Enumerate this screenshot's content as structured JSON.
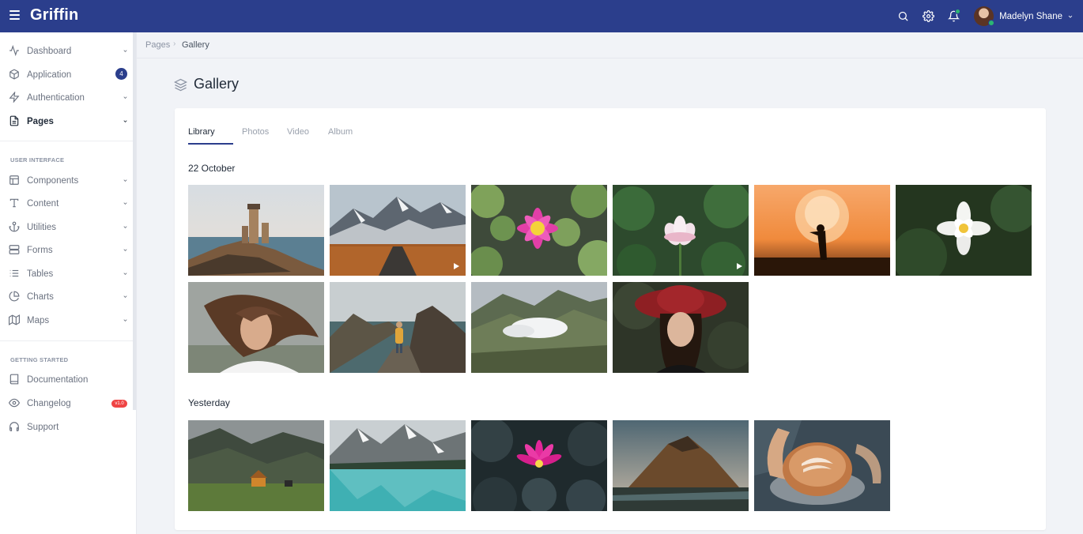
{
  "app": {
    "brand": "Griffin"
  },
  "topbar": {
    "user_name": "Madelyn Shane"
  },
  "sidebar": {
    "items": [
      {
        "label": "Dashboard",
        "icon": "activity-icon"
      },
      {
        "label": "Application",
        "icon": "box-icon",
        "badge": "4"
      },
      {
        "label": "Authentication",
        "icon": "zap-icon"
      },
      {
        "label": "Pages",
        "icon": "file-icon"
      }
    ],
    "section_ui": "USER INTERFACE",
    "ui_items": [
      {
        "label": "Components",
        "icon": "layout-icon"
      },
      {
        "label": "Content",
        "icon": "type-icon"
      },
      {
        "label": "Utilities",
        "icon": "anchor-icon"
      },
      {
        "label": "Forms",
        "icon": "server-icon"
      },
      {
        "label": "Tables",
        "icon": "list-icon"
      },
      {
        "label": "Charts",
        "icon": "pie-chart-icon"
      },
      {
        "label": "Maps",
        "icon": "map-icon"
      }
    ],
    "section_start": "GETTING STARTED",
    "start_items": [
      {
        "label": "Documentation",
        "icon": "book-icon"
      },
      {
        "label": "Changelog",
        "icon": "eye-icon",
        "badge": "v1.0"
      },
      {
        "label": "Support",
        "icon": "headphones-icon"
      }
    ]
  },
  "breadcrumb": {
    "parent": "Pages",
    "separator": "›",
    "current": "Gallery"
  },
  "page": {
    "title": "Gallery"
  },
  "tabs": [
    {
      "label": "Library",
      "active": true
    },
    {
      "label": "Photos"
    },
    {
      "label": "Video"
    },
    {
      "label": "Album"
    }
  ],
  "groups": [
    {
      "title": "22 October",
      "photos": [
        {
          "subject": "lighthouse",
          "video": false
        },
        {
          "subject": "mountain-road",
          "video": true
        },
        {
          "subject": "pink-lotus-lilypads",
          "video": false
        },
        {
          "subject": "white-pink-lotus",
          "video": true
        },
        {
          "subject": "sunset-silhouette",
          "video": false
        },
        {
          "subject": "white-water-lily",
          "video": false
        },
        {
          "subject": "windblown-hair-portrait",
          "video": false
        },
        {
          "subject": "hiker-on-cliff",
          "video": false
        },
        {
          "subject": "mountain-clouds",
          "video": false
        },
        {
          "subject": "woman-red-hat",
          "video": false
        }
      ]
    },
    {
      "title": "Yesterday",
      "photos": [
        {
          "subject": "cabin-in-valley",
          "video": false
        },
        {
          "subject": "turquoise-lake",
          "video": false
        },
        {
          "subject": "magenta-water-lily",
          "video": false
        },
        {
          "subject": "lone-mountain",
          "video": false
        },
        {
          "subject": "latte-art-cup",
          "video": false
        }
      ]
    }
  ],
  "colors": {
    "primary": "#2b3e8c",
    "online": "#2bb673",
    "badge_red": "#ef4444"
  }
}
